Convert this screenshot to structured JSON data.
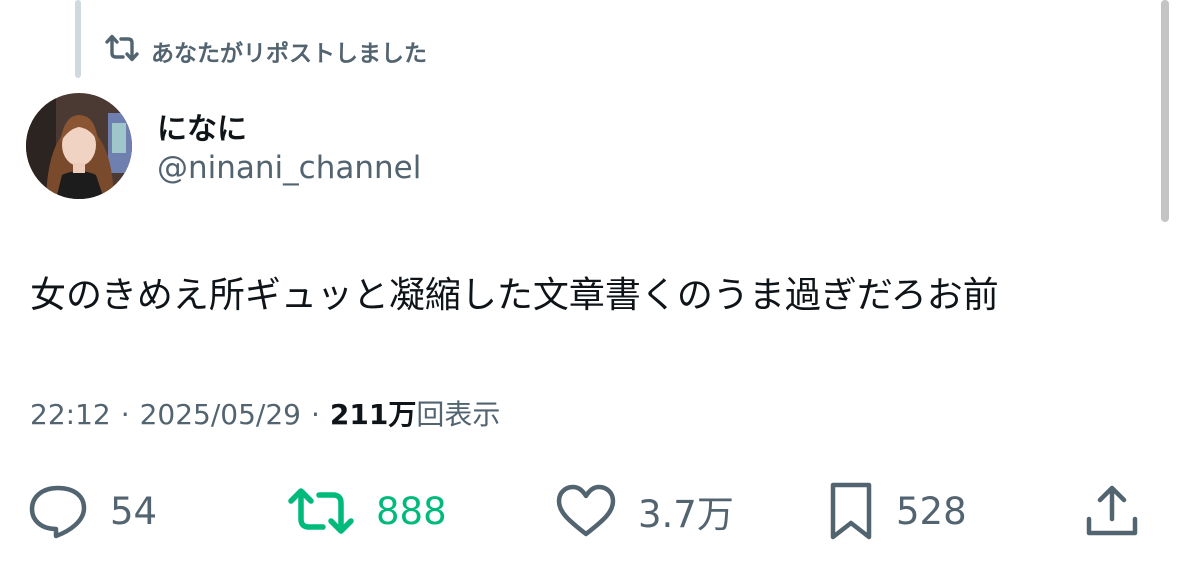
{
  "repost_banner": {
    "icon": "repost-icon",
    "label": "あなたがリポストしました"
  },
  "author": {
    "display_name": "になに",
    "handle": "@ninani_channel",
    "avatar": "avatar-photo"
  },
  "tweet": {
    "text": "女のきめえ所ギュッと凝縮した文章書くのうま過ぎだろお前"
  },
  "meta": {
    "time": "22:12",
    "separator": "·",
    "date": "2025/05/29",
    "views_count": "211万",
    "views_suffix": "回表示"
  },
  "actions": {
    "reply": {
      "icon": "reply-icon",
      "count": "54"
    },
    "retweet": {
      "icon": "repost-icon",
      "count": "888",
      "active_color": "#00ba7c"
    },
    "like": {
      "icon": "heart-icon",
      "count": "3.7万"
    },
    "bookmark": {
      "icon": "bookmark-icon",
      "count": "528"
    },
    "share": {
      "icon": "share-icon"
    }
  },
  "colors": {
    "text_primary": "#0f1419",
    "text_secondary": "#536471",
    "repost_green": "#00ba7c"
  }
}
